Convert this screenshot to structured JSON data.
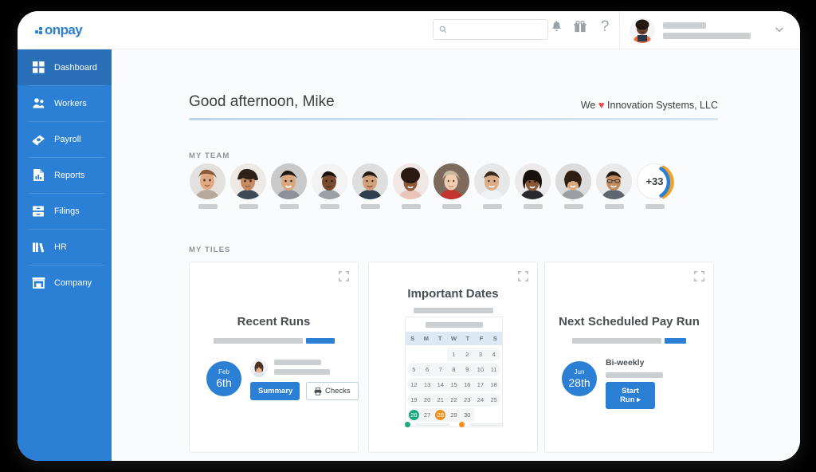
{
  "brand": {
    "name": "onpay",
    "accent": "#2b7fd4"
  },
  "header": {
    "search": {
      "placeholder": "",
      "value": "",
      "icon": "search-icon"
    },
    "icons": [
      {
        "name": "bell-icon",
        "glyph": "🔔"
      },
      {
        "name": "gift-icon",
        "glyph": "🎁"
      },
      {
        "name": "help-icon",
        "glyph": "?"
      }
    ],
    "user": {
      "avatar": "user-avatar",
      "caret": "chevron-down-icon"
    }
  },
  "sidebar": {
    "items": [
      {
        "label": "Dashboard",
        "icon": "grid-icon",
        "active": true
      },
      {
        "label": "Workers",
        "icon": "people-icon",
        "active": false
      },
      {
        "label": "Payroll",
        "icon": "money-icon",
        "active": false
      },
      {
        "label": "Reports",
        "icon": "chart-document-icon",
        "active": false
      },
      {
        "label": "Filings",
        "icon": "file-drawer-icon",
        "active": false
      },
      {
        "label": "HR",
        "icon": "books-icon",
        "active": false
      },
      {
        "label": "Company",
        "icon": "storefront-icon",
        "active": false
      }
    ]
  },
  "main": {
    "greeting": "Good afternoon, Mike",
    "company_prefix": "We",
    "company_heart": "♥",
    "company_name": "Innovation Systems, LLC",
    "team_label": "MY TEAM",
    "tiles_label": "MY TILES",
    "team": {
      "count_overflow": "+33",
      "members": [
        {
          "id": "member-1"
        },
        {
          "id": "member-2"
        },
        {
          "id": "member-3"
        },
        {
          "id": "member-4"
        },
        {
          "id": "member-5"
        },
        {
          "id": "member-6"
        },
        {
          "id": "member-7"
        },
        {
          "id": "member-8"
        },
        {
          "id": "member-9"
        },
        {
          "id": "member-10"
        },
        {
          "id": "member-11"
        }
      ]
    },
    "tiles": [
      {
        "title": "Recent Runs",
        "expand_icon": "expand-icon",
        "date_month": "Feb",
        "date_day": "6th",
        "btn_primary": "Summary",
        "btn_outline": "Checks",
        "btn_outline_icon": "printer-icon"
      },
      {
        "title": "Important Dates",
        "expand_icon": "expand-icon",
        "calendar": {
          "weekday_headers": [
            "S",
            "M",
            "T",
            "W",
            "T",
            "F",
            "S"
          ],
          "weeks": [
            [
              "",
              "",
              "",
              "1",
              "2",
              "3",
              "4"
            ],
            [
              "5",
              "6",
              "7",
              "8",
              "9",
              "10",
              "11"
            ],
            [
              "12",
              "13",
              "14",
              "15",
              "16",
              "17",
              "18"
            ],
            [
              "19",
              "20",
              "21",
              "22",
              "23",
              "24",
              "25"
            ],
            [
              "26",
              "27",
              "28",
              "29",
              "30",
              "",
              ""
            ]
          ],
          "highlights": [
            {
              "day": "26",
              "color": "#1ea97c"
            },
            {
              "day": "28",
              "color": "#f2921d"
            }
          ]
        },
        "pager": [
          {
            "color": "#1ea97c"
          },
          {
            "color": "#f2921d"
          }
        ]
      },
      {
        "title": "Next Scheduled Pay Run",
        "expand_icon": "expand-icon",
        "date_month": "Jun",
        "date_day": "28th",
        "schedule": "Bi-weekly",
        "btn_primary": "Start Run ▸"
      }
    ]
  }
}
